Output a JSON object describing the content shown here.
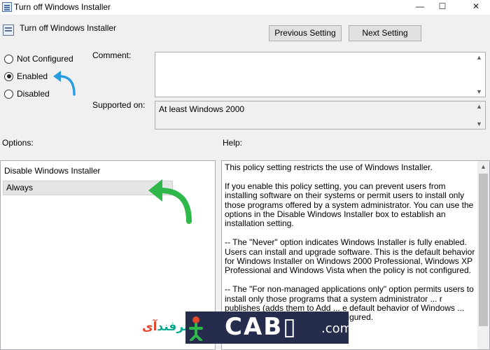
{
  "window": {
    "title": "Turn off Windows Installer",
    "minimize_glyph": "—",
    "maximize_glyph": "☐",
    "close_glyph": "✕"
  },
  "header": {
    "title": "Turn off Windows Installer"
  },
  "nav": {
    "previous_label": "Previous Setting",
    "next_label": "Next Setting"
  },
  "state": {
    "options": [
      {
        "label": "Not Configured",
        "checked": false
      },
      {
        "label": "Enabled",
        "checked": true
      },
      {
        "label": "Disabled",
        "checked": false
      }
    ]
  },
  "comment": {
    "label": "Comment:",
    "value": ""
  },
  "supported": {
    "label": "Supported on:",
    "value": "At least Windows 2000"
  },
  "options_panel": {
    "heading": "Options:",
    "field_label": "Disable Windows Installer",
    "selected": "Always"
  },
  "help_panel": {
    "heading": "Help:",
    "paragraphs": [
      "This policy setting restricts the use of Windows Installer.",
      "If you enable this policy setting, you can prevent users from installing software on their systems or permit users to install only those programs offered by a system administrator. You can use the options in the Disable Windows Installer box to establish an installation setting.",
      "-- The \"Never\" option indicates Windows Installer is fully enabled. Users can install and upgrade software. This is the default behavior for Windows Installer on Windows 2000 Professional, Windows XP Professional and Windows Vista when the policy is not configured.",
      "-- The \"For non-managed applications only\" option permits users to install only those programs that a system administrator ... r publishes (adds them to Add ... e default behavior of Windows ... family when the policy is not configured."
    ]
  },
  "watermark": {
    "fa_red": "آی",
    "fa_green": "ترفند",
    "big": "CAB▯",
    "suffix": ".com"
  },
  "colors": {
    "arrow_blue": "#2a9de0",
    "arrow_green": "#2fb84a"
  }
}
